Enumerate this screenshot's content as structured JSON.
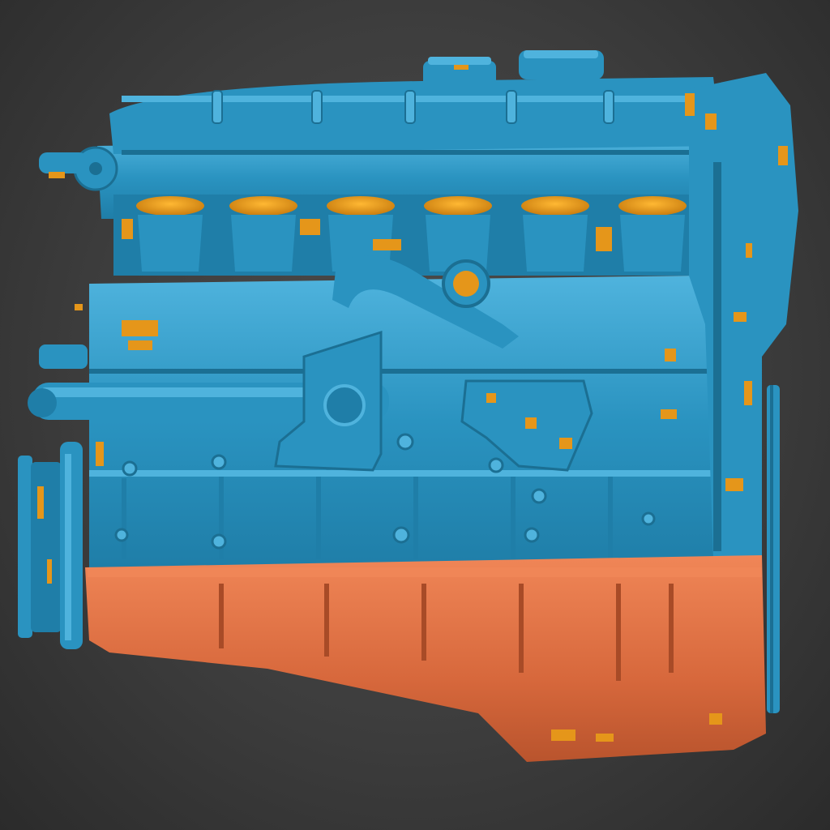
{
  "scene": {
    "subject": "engine-block-3d-scan",
    "colors": {
      "background": "#3f3f3f",
      "scan_surface": "#2a93c0",
      "scan_highlight": "#4fb3dd",
      "scan_shadow": "#1b6f93",
      "deviation_orange": "#e5961a",
      "oil_pan": "#d7683c",
      "oil_pan_highlight": "#f08657",
      "oil_pan_shadow": "#a84b27"
    }
  }
}
